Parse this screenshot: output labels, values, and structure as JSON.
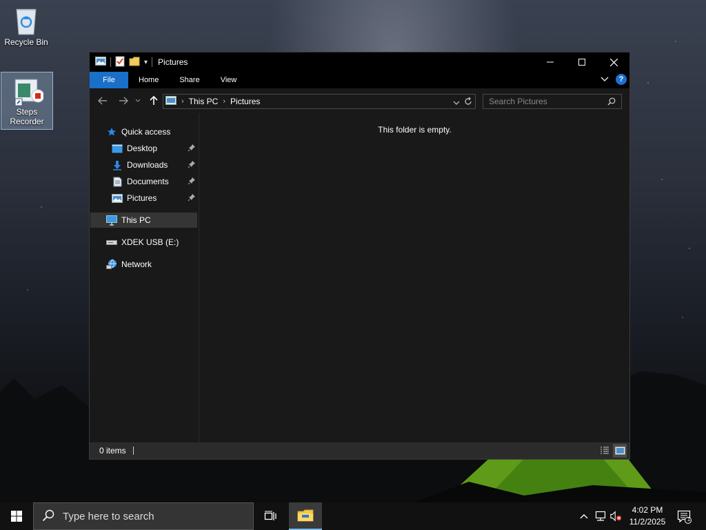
{
  "desktop": {
    "icons": [
      {
        "label": "Recycle Bin",
        "icon": "recycle-bin-icon"
      },
      {
        "label_line1": "Steps",
        "label_line2": "Recorder",
        "icon": "steps-recorder-icon"
      }
    ]
  },
  "window": {
    "title": "Pictures",
    "controls": {
      "minimize": "minimize-icon",
      "maximize": "maximize-icon",
      "close": "close-icon"
    },
    "ribbon_tabs": [
      {
        "label": "File"
      },
      {
        "label": "Home"
      },
      {
        "label": "Share"
      },
      {
        "label": "View"
      }
    ],
    "address": {
      "crumbs": [
        "This PC",
        "Pictures"
      ]
    },
    "search": {
      "placeholder": "Search Pictures"
    },
    "nav": {
      "quick_access": "Quick access",
      "pinned": [
        {
          "label": "Desktop",
          "icon": "desktop-folder-icon"
        },
        {
          "label": "Downloads",
          "icon": "downloads-icon"
        },
        {
          "label": "Documents",
          "icon": "documents-icon"
        },
        {
          "label": "Pictures",
          "icon": "pictures-icon"
        }
      ],
      "this_pc": "This PC",
      "usb": "XDEK USB (E:)",
      "network": "Network"
    },
    "content": {
      "empty_message": "This folder is empty."
    },
    "status": {
      "item_count": "0 items"
    }
  },
  "taskbar": {
    "search_placeholder": "Type here to search",
    "clock": {
      "time": "4:02 PM",
      "date": "11/2/2025"
    },
    "notification_count": "1",
    "accent": "#76b9ed"
  },
  "colors": {
    "file_tab": "#1a6fc9",
    "window_bg": "#191919",
    "selected_nav": "#353535"
  }
}
